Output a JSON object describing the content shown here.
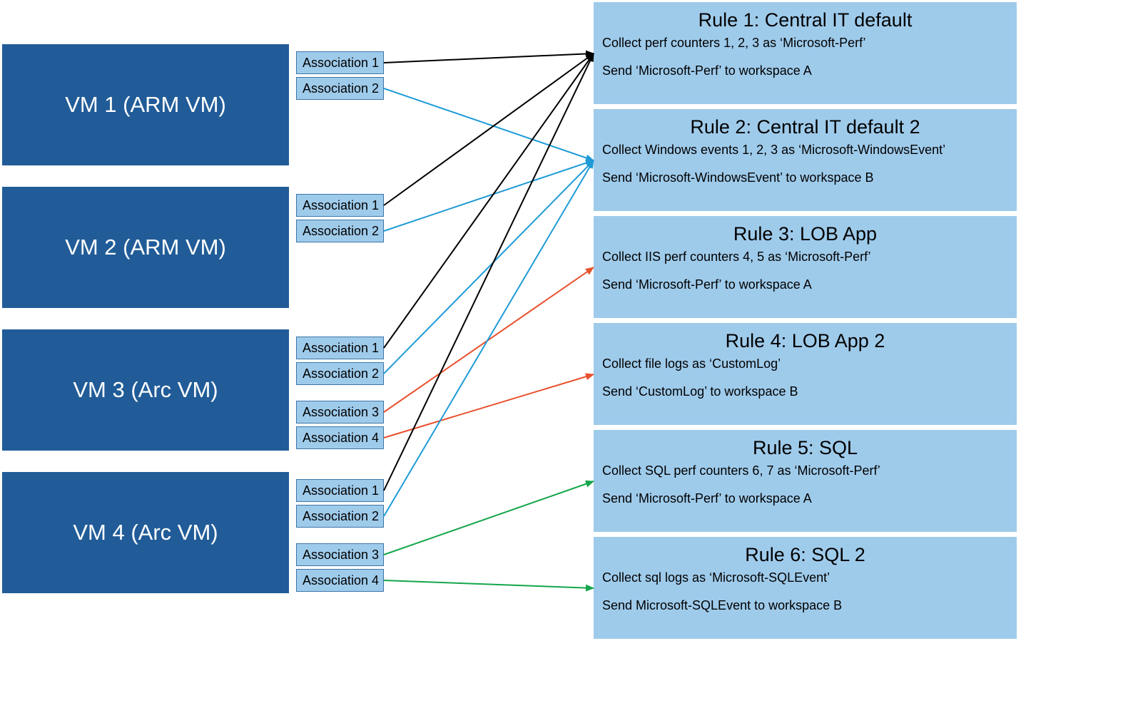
{
  "vms": [
    {
      "label": "VM 1 (ARM VM)"
    },
    {
      "label": "VM 2 (ARM VM)"
    },
    {
      "label": "VM 3 (Arc VM)"
    },
    {
      "label": "VM 4 (Arc VM)"
    }
  ],
  "assoc_labels": {
    "a1": "Association 1",
    "a2": "Association 2",
    "a3": "Association 3",
    "a4": "Association 4"
  },
  "rules": [
    {
      "title": "Rule 1: Central IT default",
      "line1": "Collect perf counters 1, 2, 3 as ‘Microsoft-Perf’",
      "line2": "Send ‘Microsoft-Perf’ to workspace A"
    },
    {
      "title": "Rule 2: Central IT default 2",
      "line1": "Collect Windows events 1, 2, 3 as ‘Microsoft-WindowsEvent’",
      "line2": "Send ‘Microsoft-WindowsEvent’ to workspace B"
    },
    {
      "title": "Rule 3: LOB App",
      "line1": "Collect IIS perf counters 4, 5 as ‘Microsoft-Perf’",
      "line2": "Send ‘Microsoft-Perf’ to workspace A"
    },
    {
      "title": "Rule 4: LOB App 2",
      "line1": "Collect file logs as ‘CustomLog’",
      "line2": "Send ‘CustomLog’ to workspace B"
    },
    {
      "title": "Rule 5: SQL",
      "line1": "Collect SQL perf counters 6, 7 as ‘Microsoft-Perf’",
      "line2": "Send ‘Microsoft-Perf’ to workspace A"
    },
    {
      "title": "Rule 6: SQL 2",
      "line1": "Collect sql logs as ‘Microsoft-SQLEvent’",
      "line2": "Send Microsoft-SQLEvent to workspace B"
    }
  ],
  "colors": {
    "black": "#000000",
    "blue": "#1F9BD7",
    "red": "#E8512E",
    "green": "#14A64A"
  },
  "connections": [
    {
      "from": "vm1-a1",
      "to": "rule1",
      "color": "black"
    },
    {
      "from": "vm1-a2",
      "to": "rule2",
      "color": "blue"
    },
    {
      "from": "vm2-a1",
      "to": "rule1",
      "color": "black"
    },
    {
      "from": "vm2-a2",
      "to": "rule2",
      "color": "blue"
    },
    {
      "from": "vm3-a1",
      "to": "rule1",
      "color": "black"
    },
    {
      "from": "vm3-a2",
      "to": "rule2",
      "color": "blue"
    },
    {
      "from": "vm3-a3",
      "to": "rule3",
      "color": "red"
    },
    {
      "from": "vm3-a4",
      "to": "rule4",
      "color": "red"
    },
    {
      "from": "vm4-a1",
      "to": "rule1",
      "color": "black"
    },
    {
      "from": "vm4-a2",
      "to": "rule2",
      "color": "blue"
    },
    {
      "from": "vm4-a3",
      "to": "rule5",
      "color": "green"
    },
    {
      "from": "vm4-a4",
      "to": "rule6",
      "color": "green"
    }
  ]
}
